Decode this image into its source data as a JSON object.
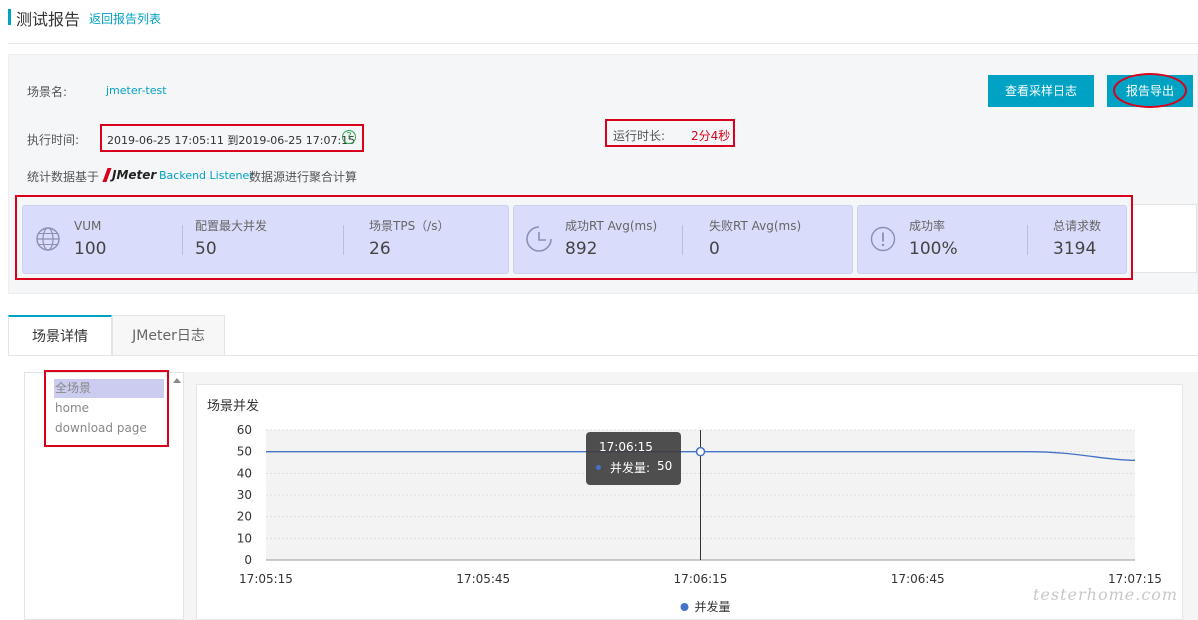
{
  "header": {
    "title": "测试报告",
    "back_link": "返回报告列表"
  },
  "info": {
    "scene_label": "场景名:",
    "scene_value": "jmeter-test",
    "exec_time_label": "执行时间:",
    "exec_time_value": "2019-06-25 17:05:11 到2019-06-25 17:07:15",
    "run_duration_label": "运行时长:",
    "run_duration_value": "2分4秒",
    "stats_prefix": "统计数据基于",
    "jmeter_logo_text": "JMeter",
    "stats_link": "Backend Listener",
    "stats_suffix": "数据源进行聚合计算"
  },
  "buttons": {
    "view_log": "查看采样日志",
    "export": "报告导出"
  },
  "metrics": [
    {
      "label": "VUM",
      "value": "100"
    },
    {
      "label": "配置最大并发",
      "value": "50"
    },
    {
      "label": "场景TPS（/s）",
      "value": "26"
    },
    {
      "label": "成功RT Avg(ms)",
      "value": "892"
    },
    {
      "label": "失败RT Avg(ms)",
      "value": "0"
    },
    {
      "label": "成功率",
      "value": "100%"
    },
    {
      "label": "总请求数",
      "value": "3194"
    }
  ],
  "metric_icons": [
    "globe-icon",
    "clock-icon",
    "exclamation-circle-icon"
  ],
  "tabs": [
    {
      "label": "场景详情",
      "active": true
    },
    {
      "label": "JMeter日志",
      "active": false
    }
  ],
  "scenes": [
    {
      "label": "全场景",
      "selected": true
    },
    {
      "label": "home"
    },
    {
      "label": "download page"
    }
  ],
  "chart_data": {
    "type": "line",
    "title": "场景并发",
    "x_ticks": [
      "17:05:15",
      "17:05:45",
      "17:06:15",
      "17:06:45",
      "17:07:15"
    ],
    "y_ticks": [
      "0",
      "10",
      "20",
      "30",
      "40",
      "50",
      "60"
    ],
    "ylim": [
      0,
      60
    ],
    "grid": true,
    "legend_position": "bottom-center",
    "series": [
      {
        "name": "并发量",
        "color": "#4472c4",
        "x": [
          "17:05:15",
          "17:05:45",
          "17:06:15",
          "17:06:45",
          "17:07:00",
          "17:07:15"
        ],
        "values": [
          50,
          50,
          50,
          50,
          50,
          46
        ]
      }
    ],
    "tooltip": {
      "time": "17:06:15",
      "series": "并发量",
      "value": "50"
    }
  },
  "tooltip_text": {
    "label": "并发量:"
  },
  "watermark": "testerhome.com",
  "colors": {
    "accent": "#00a2c4",
    "highlight": "#d9001b",
    "line": "#4472c4"
  }
}
